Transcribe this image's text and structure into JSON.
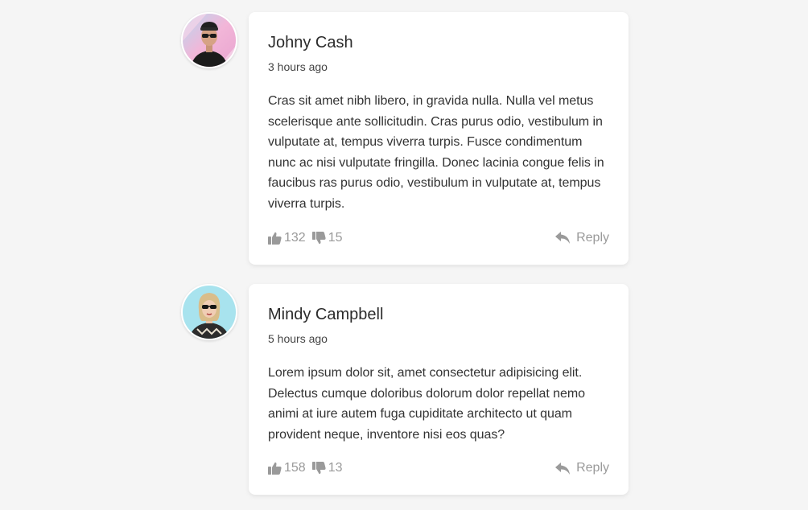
{
  "comments": [
    {
      "author": "Johny Cash",
      "time": "3 hours ago",
      "text": "Cras sit amet nibh libero, in gravida nulla. Nulla vel metus scelerisque ante sollicitudin. Cras purus odio, vestibulum in vulputate at, tempus viverra turpis. Fusce condimentum nunc ac nisi vulputate fringilla. Donec lacinia congue felis in faucibus ras purus odio, vestibulum in vulputate at, tempus viverra turpis.",
      "likes": "132",
      "dislikes": "15",
      "reply_label": "Reply"
    },
    {
      "author": "Mindy Campbell",
      "time": "5 hours ago",
      "text": "Lorem ipsum dolor sit, amet consectetur adipisicing elit. Delectus cumque doloribus dolorum dolor repellat nemo animi at iure autem fuga cupiditate architecto ut quam provident neque, inventore nisi eos quas?",
      "likes": "158",
      "dislikes": "13",
      "reply_label": "Reply"
    }
  ],
  "icons": {
    "like": "thumbs-up-icon",
    "dislike": "thumbs-down-icon",
    "reply": "reply-arrow-icon"
  },
  "colors": {
    "background": "#f5f5f5",
    "card": "#ffffff",
    "muted": "#9a9a9a"
  }
}
